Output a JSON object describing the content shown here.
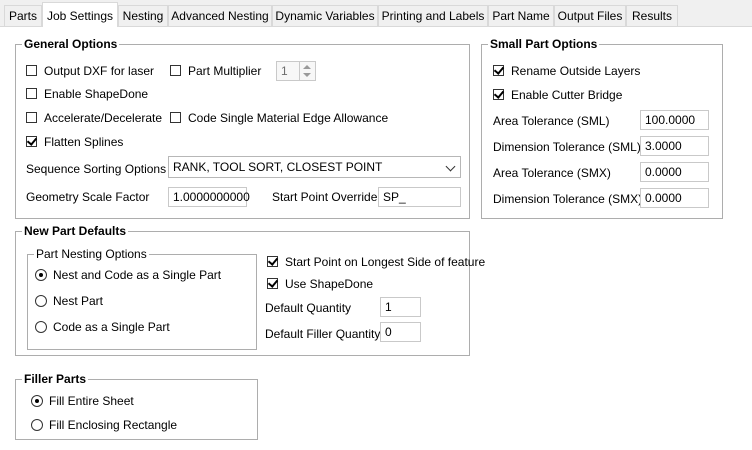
{
  "tabs": [
    {
      "label": "Parts"
    },
    {
      "label": "Job Settings",
      "active": true
    },
    {
      "label": "Nesting"
    },
    {
      "label": "Advanced Nesting"
    },
    {
      "label": "Dynamic Variables"
    },
    {
      "label": "Printing and Labels"
    },
    {
      "label": "Part Name"
    },
    {
      "label": "Output Files"
    },
    {
      "label": "Results"
    }
  ],
  "general": {
    "title": "General Options",
    "output_dxf": {
      "label": "Output DXF for laser",
      "checked": false
    },
    "part_multiplier": {
      "label": "Part Multiplier",
      "checked": false,
      "value": "1"
    },
    "enable_shapedone": {
      "label": "Enable ShapeDone",
      "checked": false
    },
    "accel_decel": {
      "label": "Accelerate/Decelerate",
      "checked": false
    },
    "code_single_material": {
      "label": "Code Single Material Edge Allowance",
      "checked": false
    },
    "flatten_splines": {
      "label": "Flatten Splines",
      "checked": true
    },
    "sequence_label": "Sequence Sorting Options",
    "sequence_value": "RANK, TOOL SORT, CLOSEST POINT",
    "geometry_label": "Geometry Scale Factor",
    "geometry_value": "1.0000000000",
    "start_point_label": "Start Point Override",
    "start_point_value": "SP_"
  },
  "small": {
    "title": "Small Part Options",
    "rename_outside": {
      "label": "Rename Outside Layers",
      "checked": true
    },
    "cutter_bridge": {
      "label": "Enable Cutter Bridge",
      "checked": true
    },
    "area_sml_label": "Area Tolerance (SML)",
    "area_sml_value": "100.0000",
    "dim_sml_label": "Dimension Tolerance (SML)",
    "dim_sml_value": "3.0000",
    "area_smx_label": "Area Tolerance (SMX)",
    "area_smx_value": "0.0000",
    "dim_smx_label": "Dimension Tolerance (SMX)",
    "dim_smx_value": "0.0000"
  },
  "npd": {
    "title": "New Part Defaults",
    "nesting_title": "Part Nesting Options",
    "radio_single": {
      "label": "Nest and Code as a Single Part",
      "checked": true
    },
    "radio_nest": {
      "label": "Nest Part",
      "checked": false
    },
    "radio_code": {
      "label": "Code as a Single Part",
      "checked": false
    },
    "start_longest": {
      "label": "Start Point on Longest Side of feature",
      "checked": true
    },
    "use_shapedone": {
      "label": "Use ShapeDone",
      "checked": true
    },
    "default_qty_label": "Default Quantity",
    "default_qty_value": "1",
    "filler_qty_label": "Default Filler Quantity",
    "filler_qty_value": "0"
  },
  "filler": {
    "title": "Filler Parts",
    "fill_sheet": {
      "label": "Fill Entire Sheet",
      "checked": true
    },
    "fill_rect": {
      "label": "Fill Enclosing Rectangle",
      "checked": false
    }
  }
}
